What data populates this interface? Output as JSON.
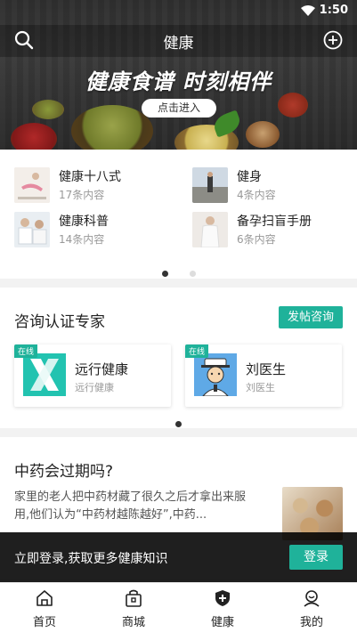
{
  "status_bar": {
    "time": "1:50"
  },
  "header": {
    "title": "健康"
  },
  "banner": {
    "slogan": "健康食谱 时刻相伴",
    "enter_label": "点击进入"
  },
  "categories": [
    {
      "name": "健康十八式",
      "count": "17条内容",
      "thumb": "yoga-photo"
    },
    {
      "name": "健身",
      "count": "4条内容",
      "thumb": "running-photo"
    },
    {
      "name": "健康科普",
      "count": "14条内容",
      "thumb": "doctor-photo"
    },
    {
      "name": "备孕扫盲手册",
      "count": "6条内容",
      "thumb": "pregnancy-photo"
    }
  ],
  "categories_pager": {
    "pages": 2,
    "active": 0
  },
  "experts": {
    "heading": "咨询认证专家",
    "post_label": "发帖咨询",
    "cards": [
      {
        "badge": "在线",
        "name": "远行健康",
        "sub": "远行健康",
        "avatar": "yuanxing-logo"
      },
      {
        "badge": "在线",
        "name": "刘医生",
        "sub": "刘医生",
        "avatar": "doctor-avatar"
      }
    ]
  },
  "article": {
    "title": "中药会过期吗?",
    "desc": "家里的老人把中药材藏了很久之后才拿出来服用,他们认为“中药材越陈越好”,中药..."
  },
  "login_bar": {
    "text": "立即登录,获取更多健康知识",
    "button": "登录"
  },
  "tabs": [
    {
      "label": "首页",
      "icon": "home-icon"
    },
    {
      "label": "商城",
      "icon": "shop-icon"
    },
    {
      "label": "健康",
      "icon": "health-shield-icon",
      "active": true
    },
    {
      "label": "我的",
      "icon": "profile-icon"
    }
  ],
  "colors": {
    "accent": "#1fb29a",
    "dark": "#2d2d2d"
  }
}
